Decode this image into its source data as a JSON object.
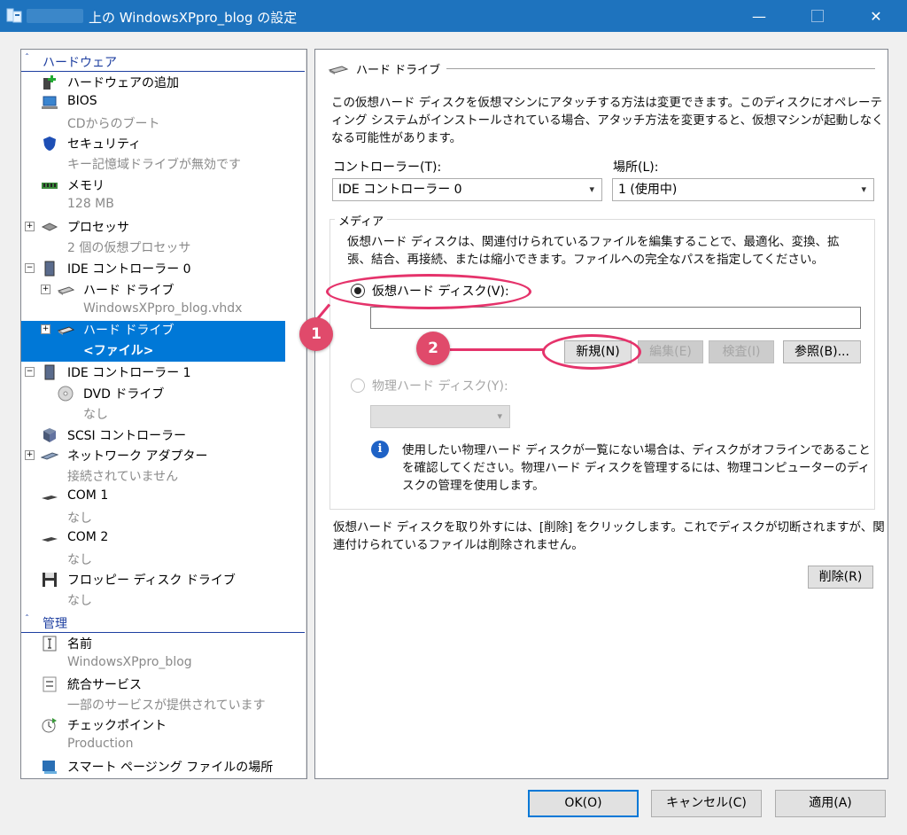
{
  "window": {
    "title": "上の WindowsXPpro_blog の設定",
    "min": "—",
    "close": "✕"
  },
  "tree": {
    "hardware_header": "ハードウェア",
    "management_header": "管理",
    "chevron": "ˆ",
    "items": [
      {
        "label": "ハードウェアの追加",
        "sub": ""
      },
      {
        "label": "BIOS",
        "sub": "CDからのブート"
      },
      {
        "label": "セキュリティ",
        "sub": "キー記憶域ドライブが無効です"
      },
      {
        "label": "メモリ",
        "sub": "128 MB"
      },
      {
        "label": "プロセッサ",
        "sub": "2 個の仮想プロセッサ"
      },
      {
        "label": "IDE コントローラー 0",
        "sub": ""
      },
      {
        "label": "ハード ドライブ",
        "sub": "WindowsXPpro_blog.vhdx"
      },
      {
        "label": "ハード ドライブ",
        "sub": "<ファイル>"
      },
      {
        "label": "IDE コントローラー 1",
        "sub": ""
      },
      {
        "label": "DVD ドライブ",
        "sub": "なし"
      },
      {
        "label": "SCSI コントローラー",
        "sub": ""
      },
      {
        "label": "ネットワーク アダプター",
        "sub": "接続されていません"
      },
      {
        "label": "COM 1",
        "sub": "なし"
      },
      {
        "label": "COM 2",
        "sub": "なし"
      },
      {
        "label": "フロッピー ディスク ドライブ",
        "sub": "なし"
      }
    ],
    "mgmt_items": [
      {
        "label": "名前",
        "sub": "WindowsXPpro_blog"
      },
      {
        "label": "統合サービス",
        "sub": "一部のサービスが提供されています"
      },
      {
        "label": "チェックポイント",
        "sub": "Production"
      },
      {
        "label": "スマート ページング ファイルの場所",
        "sub": ""
      }
    ]
  },
  "panel": {
    "group_title": "ハード ドライブ",
    "intro_line1": "この仮想ハード ディスクを仮想マシンにアタッチする方法は変更できます。このディスクにオペレーテ",
    "intro_line2": "ィング システムがインストールされている場合、アタッチ方法を変更すると、仮想マシンが起動しなく",
    "intro_line3": "なる可能性があります。",
    "controller_label": "コントローラー(T):",
    "controller_value": "IDE コントローラー 0",
    "location_label": "場所(L):",
    "location_value": "1 (使用中)",
    "media_legend": "メディア",
    "media_desc1": "仮想ハード ディスクは、関連付けられているファイルを編集することで、最適化、変換、拡",
    "media_desc2": "張、結合、再接続、または縮小できます。ファイルへの完全なパスを指定してください。",
    "virtual_disk_label": "仮想ハード ディスク(V):",
    "virtual_disk_path": "",
    "btn_new": "新規(N)",
    "btn_edit": "編集(E)",
    "btn_inspect": "検査(I)",
    "btn_browse": "参照(B)...",
    "physical_disk_label": "物理ハード ディスク(Y):",
    "info_icon": "i",
    "info1": "使用したい物理ハード ディスクが一覧にない場合は、ディスクがオフラインであること",
    "info2": "を確認してください。物理ハード ディスクを管理するには、物理コンピューターのディ",
    "info3": "スクの管理を使用します。",
    "remove_desc1": "仮想ハード ディスクを取り外すには、[削除] をクリックします。これでディスクが切断されますが、関",
    "remove_desc2": "連付けられているファイルは削除されません。",
    "btn_remove": "削除(R)"
  },
  "annotations": {
    "badge1": "1",
    "badge2": "2"
  },
  "footer": {
    "ok": "OK(O)",
    "cancel": "キャンセル(C)",
    "apply": "適用(A)"
  }
}
